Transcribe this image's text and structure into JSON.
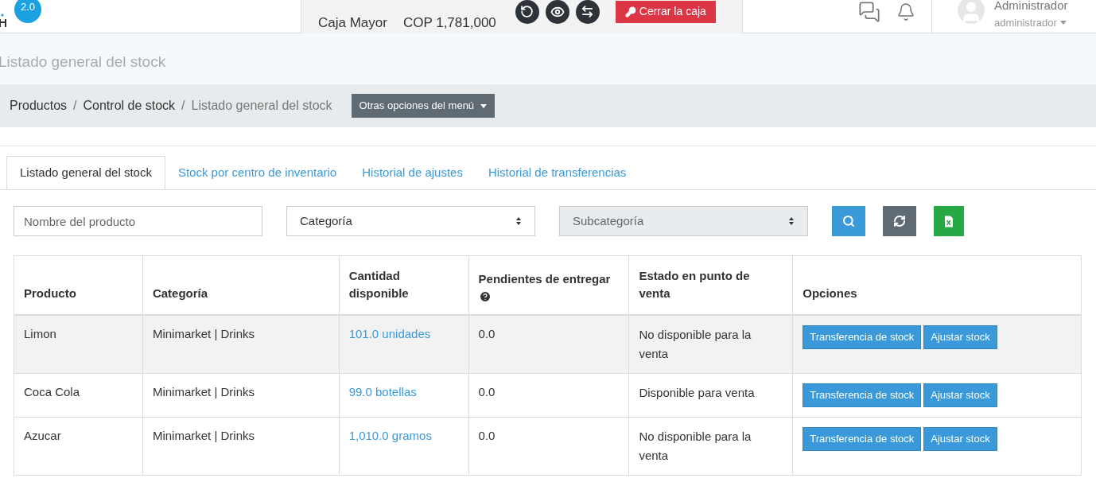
{
  "header": {
    "version_badge": "2.0",
    "cash_register": {
      "name": "Caja Mayor",
      "balance": "COP 1,781,000",
      "close_button": "Cerrar la caja"
    },
    "user": {
      "name": "Administrador",
      "role": "administrador"
    }
  },
  "page_title": "Listado general del stock",
  "breadcrumb_separator": "/",
  "breadcrumb": [
    {
      "label": "Productos",
      "current": false
    },
    {
      "label": "Control de stock",
      "current": false
    },
    {
      "label": "Listado general del stock",
      "current": true
    }
  ],
  "menu_button": "Otras opciones del menú",
  "tabs": [
    {
      "label": "Listado general del stock",
      "selected": true
    },
    {
      "label": "Stock por centro de inventario",
      "selected": false
    },
    {
      "label": "Historial de ajustes",
      "selected": false
    },
    {
      "label": "Historial de transferencias",
      "selected": false
    }
  ],
  "filters": [
    {
      "kind": "input",
      "placeholder": "Nombre del producto",
      "disabled": false
    },
    {
      "kind": "select",
      "placeholder": "Categoría",
      "disabled": false
    },
    {
      "kind": "select",
      "placeholder": "Subcategoría",
      "disabled": true
    }
  ],
  "table": {
    "columns": [
      "Producto",
      "Categoría",
      "Cantidad disponible",
      "Pendientes de entregar",
      "Estado en punto de venta",
      "Opciones"
    ],
    "rows": [
      {
        "product": "Limon",
        "category": "Minimarket | Drinks",
        "quantity": "101.0 unidades",
        "pending": "0.0",
        "status": "No disponible para la venta",
        "selected": true,
        "actions": [
          "Transferencia de stock",
          "Ajustar stock"
        ]
      },
      {
        "product": "Coca Cola",
        "category": "Minimarket | Drinks",
        "quantity": "99.0 botellas",
        "pending": "0.0",
        "status": "Disponible para venta",
        "selected": false,
        "actions": [
          "Transferencia de stock",
          "Ajustar stock"
        ]
      },
      {
        "product": "Azucar",
        "category": "Minimarket | Drinks",
        "quantity": "1,010.0 gramos",
        "pending": "0.0",
        "status": "No disponible para la venta",
        "selected": false,
        "actions": [
          "Transferencia de stock",
          "Ajustar stock"
        ]
      }
    ]
  }
}
